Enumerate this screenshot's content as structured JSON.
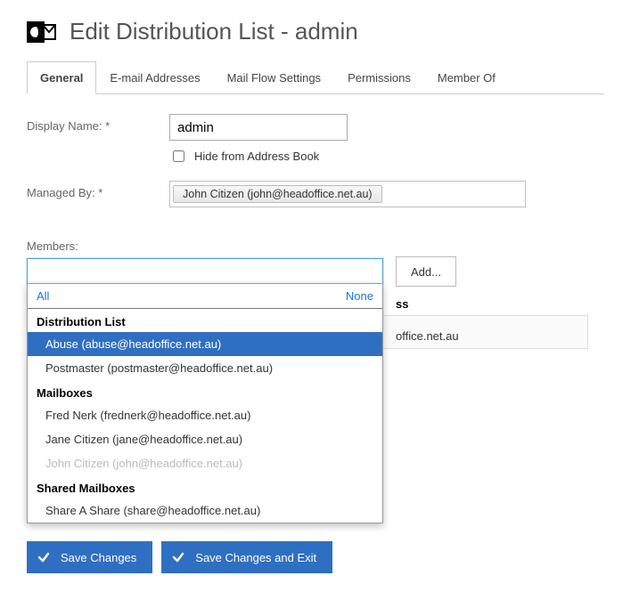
{
  "header": {
    "title": "Edit Distribution List - admin"
  },
  "tabs": [
    {
      "label": "General",
      "active": true
    },
    {
      "label": "E-mail Addresses"
    },
    {
      "label": "Mail Flow Settings"
    },
    {
      "label": "Permissions"
    },
    {
      "label": "Member Of"
    }
  ],
  "fields": {
    "displayName": {
      "label": "Display Name: *",
      "value": "admin"
    },
    "hideFromAddressBook": {
      "label": "Hide from Address Book",
      "checked": false
    },
    "managedBy": {
      "label": "Managed By: *",
      "chip": "John Citizen (john@headoffice.net.au)"
    },
    "members": {
      "label": "Members:",
      "addButton": "Add..."
    }
  },
  "dropdown": {
    "allLabel": "All",
    "noneLabel": "None",
    "groups": [
      {
        "header": "Distribution List",
        "items": [
          {
            "label": "Abuse (abuse@headoffice.net.au)",
            "selected": true
          },
          {
            "label": "Postmaster (postmaster@headoffice.net.au)"
          }
        ]
      },
      {
        "header": "Mailboxes",
        "items": [
          {
            "label": "Fred Nerk (frednerk@headoffice.net.au)"
          },
          {
            "label": "Jane Citizen (jane@headoffice.net.au)"
          },
          {
            "label": "John Citizen (john@headoffice.net.au)",
            "disabled": true
          }
        ]
      },
      {
        "header": "Shared Mailboxes",
        "items": [
          {
            "label": "Share A Share (share@headoffice.net.au)"
          }
        ]
      }
    ]
  },
  "behind": {
    "columnHeader": "ss",
    "email": "office.net.au"
  },
  "buttons": {
    "save": "Save Changes",
    "saveExit": "Save Changes and Exit"
  }
}
